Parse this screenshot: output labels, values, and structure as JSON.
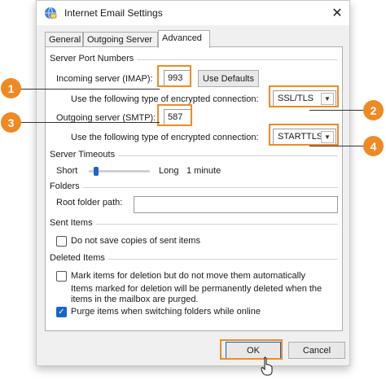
{
  "window": {
    "title": "Internet Email Settings",
    "close_glyph": "✕",
    "icon": "globe-mail-icon"
  },
  "tabs": [
    {
      "label": "General",
      "active": false
    },
    {
      "label": "Outgoing Server",
      "active": false
    },
    {
      "label": "Advanced",
      "active": true
    }
  ],
  "server_ports": {
    "group_label": "Server Port Numbers",
    "incoming_label": "Incoming server (IMAP):",
    "incoming_value": "993",
    "use_defaults_label": "Use Defaults",
    "incoming_encryption_label": "Use the following type of encrypted connection:",
    "incoming_encryption_value": "SSL/TLS",
    "outgoing_label": "Outgoing server (SMTP):",
    "outgoing_value": "587",
    "outgoing_encryption_label": "Use the following type of encrypted connection:",
    "outgoing_encryption_value": "STARTTLS"
  },
  "timeouts": {
    "group_label": "Server Timeouts",
    "short_label": "Short",
    "long_label": "Long",
    "value_text": "1 minute",
    "slider_fraction": 0.08
  },
  "folders": {
    "group_label": "Folders",
    "root_label": "Root folder path:",
    "root_value": ""
  },
  "sent_items": {
    "group_label": "Sent Items",
    "do_not_save_label": "Do not save copies of sent items",
    "do_not_save_checked": false
  },
  "deleted_items": {
    "group_label": "Deleted Items",
    "mark_label": "Mark items for deletion but do not move them automatically",
    "mark_checked": false,
    "note": "Items marked for deletion will be permanently deleted when the items in the mailbox are purged.",
    "purge_label": "Purge items when switching folders while online",
    "purge_checked": true
  },
  "footer": {
    "ok_label": "OK",
    "cancel_label": "Cancel"
  },
  "callouts": [
    "1",
    "2",
    "3",
    "4"
  ],
  "colors": {
    "accent_orange": "#ee8a24",
    "checkbox_blue": "#1a66c8"
  }
}
